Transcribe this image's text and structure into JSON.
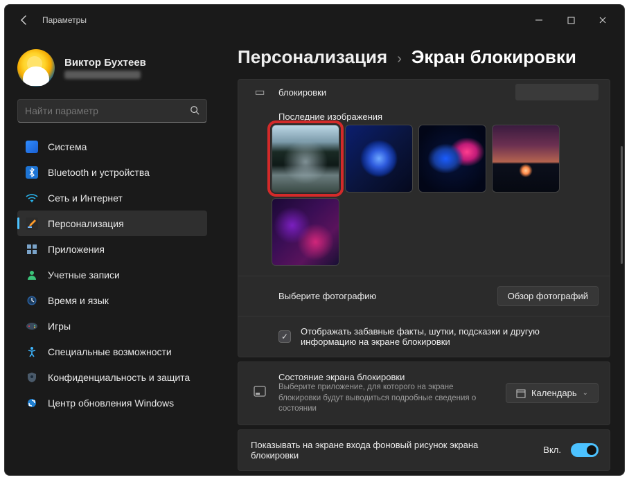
{
  "title": "Параметры",
  "user": {
    "name": "Виктор Бухтеев"
  },
  "search": {
    "placeholder": "Найти параметр"
  },
  "sidebar": {
    "items": [
      {
        "label": "Система"
      },
      {
        "label": "Bluetooth и устройства"
      },
      {
        "label": "Сеть и Интернет"
      },
      {
        "label": "Персонализация"
      },
      {
        "label": "Приложения"
      },
      {
        "label": "Учетные записи"
      },
      {
        "label": "Время и язык"
      },
      {
        "label": "Игры"
      },
      {
        "label": "Специальные возможности"
      },
      {
        "label": "Конфиденциальность и защита"
      },
      {
        "label": "Центр обновления Windows"
      }
    ]
  },
  "breadcrumb": {
    "parent": "Персонализация",
    "sep": "›",
    "current": "Экран блокировки"
  },
  "main": {
    "truncated_label": "блокировки",
    "recent_label": "Последние изображения",
    "choose_photo_label": "Выберите фотографию",
    "browse_button": "Обзор фотографий",
    "fun_facts": "Отображать забавные факты, шутки, подсказки и другую информацию на экране блокировки",
    "status": {
      "title": "Состояние экрана блокировки",
      "desc": "Выберите приложение, для которого на экране блокировки будут выводиться подробные сведения о состоянии",
      "app": "Календарь"
    },
    "show_bg": {
      "label": "Показывать на экране входа фоновый рисунок экрана блокировки",
      "state": "Вкл."
    }
  }
}
